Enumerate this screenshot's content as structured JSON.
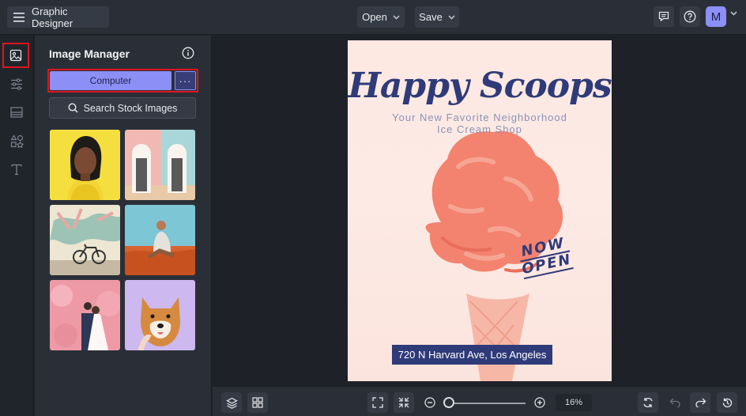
{
  "header": {
    "app_title": "Graphic Designer",
    "open_label": "Open",
    "save_label": "Save",
    "avatar_initial": "M"
  },
  "rail": {
    "items": [
      "image-manager",
      "adjustments",
      "layouts",
      "graphics",
      "text"
    ]
  },
  "panel": {
    "title": "Image Manager",
    "computer_label": "Computer",
    "more_label": "···",
    "search_label": "Search Stock Images"
  },
  "poster": {
    "title": "Happy Scoops",
    "subtitle_line1": "Your New Favorite Neighborhood",
    "subtitle_line2": "Ice Cream Shop",
    "badge_line1": "NOW",
    "badge_line2": "OPEN",
    "address": "720 N Harvard Ave, Los Angeles"
  },
  "footer": {
    "zoom_label": "16%",
    "zoom_fraction": 0.02
  },
  "colors": {
    "accent": "#8c8ff5",
    "highlight": "#e0141c",
    "poster_navy": "#2f3b78",
    "ice_cream": "#f3826f"
  }
}
